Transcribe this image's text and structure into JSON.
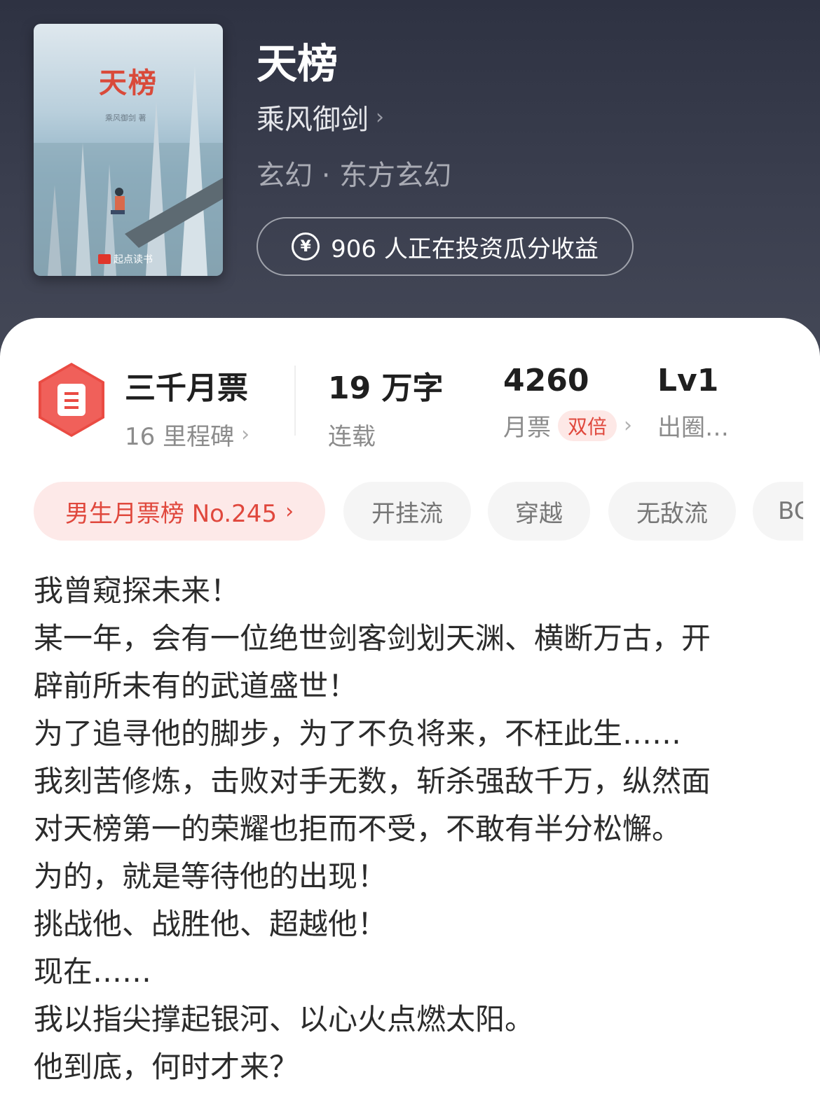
{
  "book": {
    "cover": {
      "title": "天榜",
      "author_line": "乘风御剑 著",
      "publisher": "起点读书"
    },
    "title": "天榜",
    "author": "乘风御剑",
    "genre": "玄幻 · 东方玄幻",
    "invest_text": "906 人正在投资瓜分收益"
  },
  "stats": {
    "tickets": {
      "title": "三千月票",
      "sub": "16 里程碑"
    },
    "words": {
      "value": "19 万字",
      "label": "连载"
    },
    "monthly": {
      "value": "4260",
      "label": "月票",
      "badge": "双倍"
    },
    "level": {
      "value": "Lv1",
      "label": "出圈…"
    }
  },
  "tags": [
    "男生月票榜 No.245",
    "开挂流",
    "穿越",
    "无敌流",
    "BG"
  ],
  "intro": [
    "我曾窥探未来！",
    "某一年，会有一位绝世剑客剑划天渊、横断万古，开",
    "辟前所未有的武道盛世！",
    "为了追寻他的脚步，为了不负将来，不枉此生……",
    "我刻苦修炼，击败对手无数，斩杀强敌千万，纵然面",
    "对天榜第一的荣耀也拒而不受，不敢有半分松懈。",
    "为的，就是等待他的出现！",
    "挑战他、战胜他、超越他！",
    "现在……",
    "我以指尖撑起银河、以心火点燃太阳。",
    "他到底，何时才来？"
  ],
  "colors": {
    "accent": "#e0483d",
    "header_bg": "#3b3f4f"
  }
}
